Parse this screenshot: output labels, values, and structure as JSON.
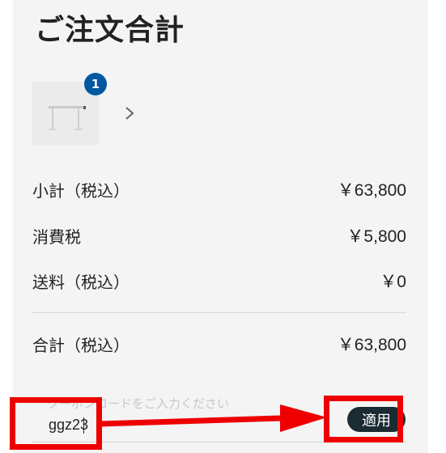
{
  "order_summary": {
    "title": "ご注文合計",
    "cart_badge_count": "1",
    "rows": [
      {
        "label": "小計（税込）",
        "value": "￥63,800"
      },
      {
        "label": "消費税",
        "value": "￥5,800"
      },
      {
        "label": "送料（税込）",
        "value": "￥0"
      }
    ],
    "total": {
      "label": "合計（税込）",
      "value": "￥63,800"
    }
  },
  "coupon": {
    "placeholder": "クーポンコードをご入力ください",
    "value": "ggz23",
    "apply_label": "適用"
  },
  "colors": {
    "badge": "#0058a3",
    "apply_button": "#1a2b33",
    "highlight": "#ee0000",
    "panel_bg": "#f4f4f4"
  },
  "icons": {
    "thumbnail": "desk-frame-thumbnail",
    "expand": "chevron-right-icon"
  }
}
